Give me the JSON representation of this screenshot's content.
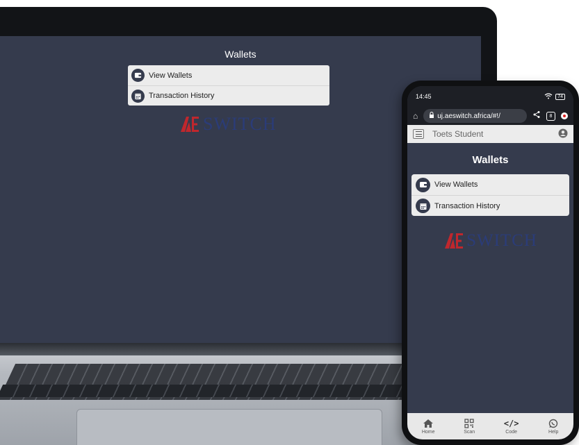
{
  "laptop": {
    "page_title": "Wallets",
    "menu": [
      {
        "label": "View Wallets",
        "icon": "wallet-icon"
      },
      {
        "label": "Transaction History",
        "icon": "calendar-icon"
      }
    ],
    "logo_text": "SWITCH"
  },
  "phone": {
    "status": {
      "time": "14:45",
      "battery": "74"
    },
    "browser": {
      "url": "uj.aeswitch.africa/#!/",
      "tab_count": "8"
    },
    "appbar": {
      "user_name": "Toets Student"
    },
    "page_title": "Wallets",
    "menu": [
      {
        "label": "View Wallets",
        "icon": "wallet-icon"
      },
      {
        "label": "Transaction History",
        "icon": "calendar-icon"
      }
    ],
    "logo_text": "SWITCH",
    "bottom_nav": [
      {
        "label": "Home",
        "icon": "home-icon"
      },
      {
        "label": "Scan",
        "icon": "qr-icon"
      },
      {
        "label": "Code",
        "icon": "code-icon"
      },
      {
        "label": "Help",
        "icon": "whatsapp-icon"
      }
    ]
  },
  "colors": {
    "screen_bg": "#353b4d",
    "list_bg": "#ececec",
    "logo_red": "#c0272d",
    "logo_navy": "#2b3c78"
  }
}
